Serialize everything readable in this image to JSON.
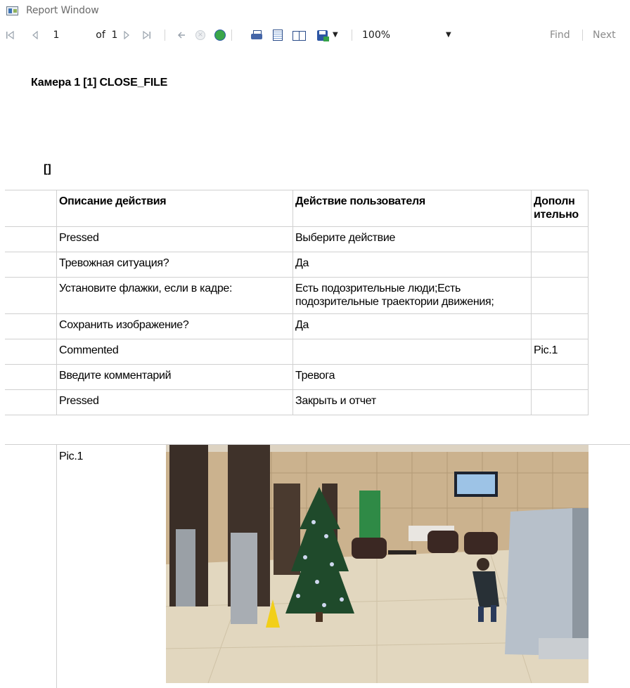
{
  "window": {
    "title": "Report Window"
  },
  "toolbar": {
    "page_current": "1",
    "page_of": "of",
    "page_total": "1",
    "zoom": "100%",
    "find_label": "Find",
    "next_label": "Next"
  },
  "report": {
    "title": "Камера 1 [1] CLOSE_FILE",
    "bracket_text": "[]",
    "table": {
      "headers": [
        "Описание действия",
        "Действие пользователя",
        "Дополн ительно"
      ],
      "rows": [
        [
          "Pressed",
          "Выберите действие",
          ""
        ],
        [
          "Тревожная ситуация?",
          "Да",
          ""
        ],
        [
          "Установите флажки, если в кадре:",
          "Есть подозрительные люди;Есть подозрительные траектории движения;",
          ""
        ],
        [
          "Сохранить изображение?",
          "Да",
          ""
        ],
        [
          "Commented",
          "",
          "Pic.1"
        ],
        [
          "Введите комментарий",
          "Тревога",
          ""
        ],
        [
          "Pressed",
          "Закрыть и отчет",
          ""
        ]
      ]
    },
    "picture_label": "Pic.1"
  },
  "colors": {
    "grid": "#d0d0d0",
    "toolbar_disabled": "#9aa3ad"
  }
}
